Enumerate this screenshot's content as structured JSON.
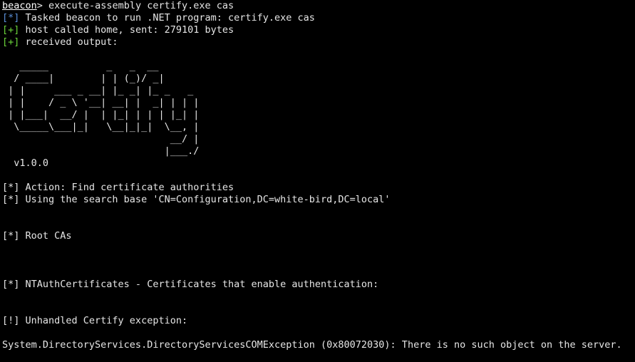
{
  "colors": {
    "background": "#000000",
    "text": "#e6e6e6",
    "info_tag": "#5a8fd6",
    "ok_tag": "#6bd43a"
  },
  "command": {
    "prompt": "beacon",
    "separator": "> ",
    "text": "execute-assembly certify.exe cas"
  },
  "beacon_msgs": [
    {
      "tag": "[*]",
      "text": " Tasked beacon to run .NET program: certify.exe cas"
    },
    {
      "tag": "[+]",
      "text": " host called home, sent: 279101 bytes"
    },
    {
      "tag": "[+]",
      "text": " received output:"
    }
  ],
  "banner": "   _____          _   _  __\n  / ____|        | | (_)/ _|\n | |     ___ _ __| |_ _| |_ _   _\n | |    / _ \\ '__| __| |  _| | | |\n | |___|  __/ |  | |_| | | | |_| |\n  \\_____\\___|_|   \\__|_|_|  \\__, |\n                             __/ |\n                            |___./",
  "version": "  v1.0.0",
  "output": {
    "action": "[*] Action: Find certificate authorities",
    "search_base": "[*] Using the search base 'CN=Configuration,DC=white-bird,DC=local'",
    "root_cas": "[*] Root CAs",
    "ntauth": "[*] NTAuthCertificates - Certificates that enable authentication:",
    "exception": "[!] Unhandled Certify exception:",
    "error": "System.DirectoryServices.DirectoryServicesCOMException (0x80072030): There is no such object on the server."
  }
}
